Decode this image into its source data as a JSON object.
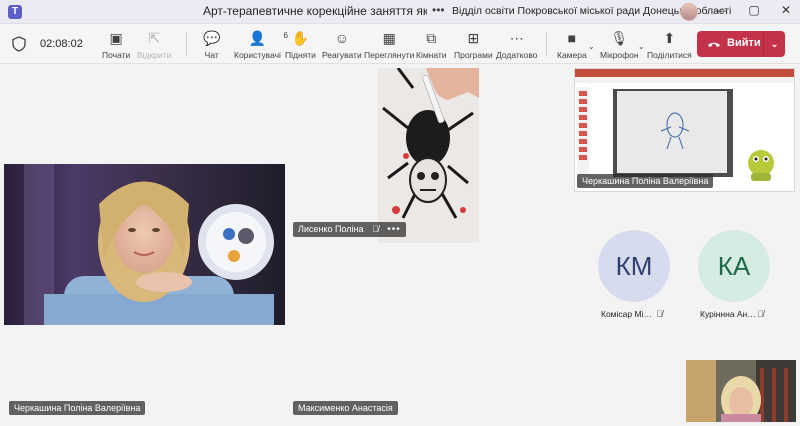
{
  "window": {
    "title": "Арт-терапевтичне корекційне заняття як зас…",
    "dots": "•••",
    "organization": "Відділ освіти Покровської міської ради Донецької області",
    "controls": {
      "minimize": "—",
      "maximize": "▢",
      "close": "✕"
    }
  },
  "meeting": {
    "timer": "02:08:02",
    "tools": {
      "start": "Почати",
      "open": "Відкрити",
      "chat": "Чат",
      "people": "Користувачі",
      "people_count": "6",
      "raise": "Підняти",
      "react": "Реагувати",
      "view": "Переглянути",
      "rooms": "Кімнати",
      "apps": "Програми",
      "more": "Додатково",
      "camera": "Камера",
      "mic": "Мікрофон",
      "share": "Поділитися"
    },
    "leave_label": "Вийти"
  },
  "participants": {
    "main_left": "Черкашина Поліна Валеріївна",
    "drawing": "Лисенко Поліна",
    "screen_share": "Черкашина Поліна Валеріївна",
    "bottom_center": "Максименко Анастасія",
    "avatars": [
      {
        "initials": "КМ",
        "name": "Комісар Мі…",
        "bg": "#d6dcee",
        "fg": "#2f3f6e"
      },
      {
        "initials": "КА",
        "name": "Куріннна Ан…",
        "bg": "#d6ece3",
        "fg": "#1e6a4b"
      }
    ]
  },
  "colors": {
    "leave": "#c4314b",
    "accent": "#5b5fc7"
  }
}
